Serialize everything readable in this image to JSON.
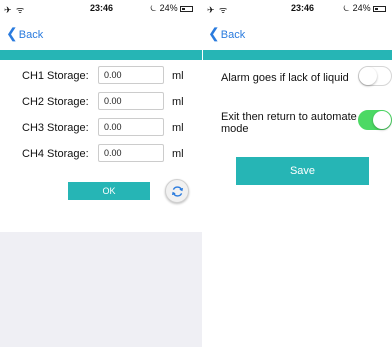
{
  "left": {
    "status": {
      "left": "✈ ᯤ",
      "time": "23:46",
      "battery": "⏾ 24%"
    },
    "back_label": "Back",
    "rows": [
      {
        "label": "CH1 Storage:",
        "value": "0.00",
        "unit": "ml"
      },
      {
        "label": "CH2 Storage:",
        "value": "0.00",
        "unit": "ml"
      },
      {
        "label": "CH3 Storage:",
        "value": "0.00",
        "unit": "ml"
      },
      {
        "label": "CH4 Storage:",
        "value": "0.00",
        "unit": "ml"
      }
    ],
    "ok_label": "OK"
  },
  "right": {
    "status": {
      "left": "✈ ᯤ",
      "time": "23:46",
      "battery": "⏾ 24%"
    },
    "back_label": "Back",
    "alarm_label": "Alarm goes if lack of liquid",
    "alarm_on": false,
    "exit_label_line1": "Exit then return to automate",
    "exit_label_line2": "mode",
    "exit_on": true,
    "save_label": "Save"
  },
  "colors": {
    "teal": "#26b5b5",
    "ios_blue": "#2a7bde",
    "toggle_on": "#4cd964",
    "panel_gray": "#efeff4"
  }
}
